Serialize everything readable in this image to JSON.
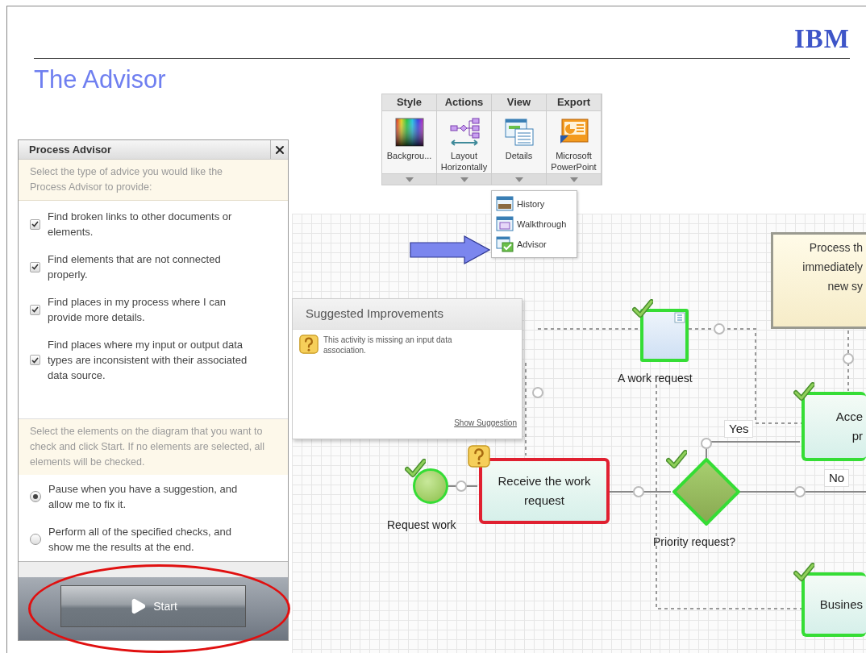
{
  "slide": {
    "logo": "IBM",
    "title": "The Advisor"
  },
  "advisor_panel": {
    "title": "Process Advisor",
    "intro": "Select the type of advice you would like the Process Advisor to provide:",
    "checks": [
      {
        "label": "Find broken links to other documents or elements.",
        "checked": true
      },
      {
        "label": "Find elements that are not connected properly.",
        "checked": true
      },
      {
        "label": "Find places in my process where I can provide more details.",
        "checked": true
      },
      {
        "label": "Find places where my input or output data types are inconsistent with their associated data source.",
        "checked": true
      }
    ],
    "instruction": "Select the elements on the diagram that you want to check and click Start.  If no elements are selected, all elements will be checked.",
    "modes": [
      {
        "label": "Pause when you have a suggestion, and allow me to fix it.",
        "selected": true
      },
      {
        "label": "Perform all of the specified checks, and show me the results at the end.",
        "selected": false
      }
    ],
    "start_button": "Start"
  },
  "ribbon": {
    "groups": [
      {
        "title": "Style",
        "label": "Backgrou..."
      },
      {
        "title": "Actions",
        "label": "Layout Horizontally"
      },
      {
        "title": "View",
        "label": "Details"
      },
      {
        "title": "Export",
        "label": "Microsoft PowerPoint"
      }
    ]
  },
  "view_menu": {
    "items": [
      "History",
      "Walkthrough",
      "Advisor"
    ]
  },
  "suggestions": {
    "title": "Suggested Improvements",
    "message": "This activity is missing an input data association.",
    "link": "Show Suggestion"
  },
  "diagram": {
    "nodes": [
      {
        "kind": "note",
        "lines": [
          "Process th",
          "immediately",
          "new sy"
        ]
      },
      {
        "kind": "data",
        "label": "A work request",
        "flagged": false
      },
      {
        "kind": "task",
        "lines": [
          "Acce",
          "pr"
        ],
        "flagged": false
      },
      {
        "kind": "start",
        "label": "Request work",
        "flagged": false
      },
      {
        "kind": "task",
        "lines": [
          "Receive the work",
          "request"
        ],
        "flagged": true
      },
      {
        "kind": "gateway",
        "label": "Priority request?",
        "flagged": false
      },
      {
        "kind": "task",
        "lines": [
          "Busines"
        ],
        "flagged": false
      }
    ],
    "flow_labels": [
      "Yes",
      "No"
    ]
  }
}
